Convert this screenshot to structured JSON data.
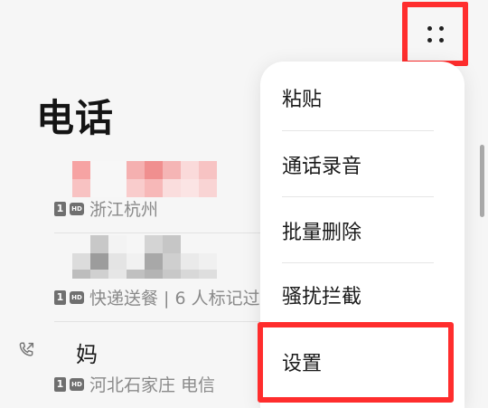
{
  "header": {
    "title": "电话",
    "more_icon": "more-grid-icon"
  },
  "calls": [
    {
      "name": "",
      "location": "浙江杭州",
      "sim": "1",
      "hd": "HD"
    },
    {
      "name": "",
      "location": "快递送餐 | 6 人标记过",
      "sim": "1",
      "hd": "HD"
    },
    {
      "name": "妈",
      "location": "河北石家庄 电信",
      "sim": "1",
      "hd": "HD",
      "icon": "outgoing-call-icon"
    }
  ],
  "menu": {
    "items": [
      {
        "label": "粘贴"
      },
      {
        "label": "通话录音"
      },
      {
        "label": "批量删除"
      },
      {
        "label": "骚扰拦截"
      },
      {
        "label": "设置"
      }
    ]
  },
  "colors": {
    "highlight": "#ff2d2d",
    "background": "#f6f6f6",
    "menu_bg": "#ffffff"
  }
}
